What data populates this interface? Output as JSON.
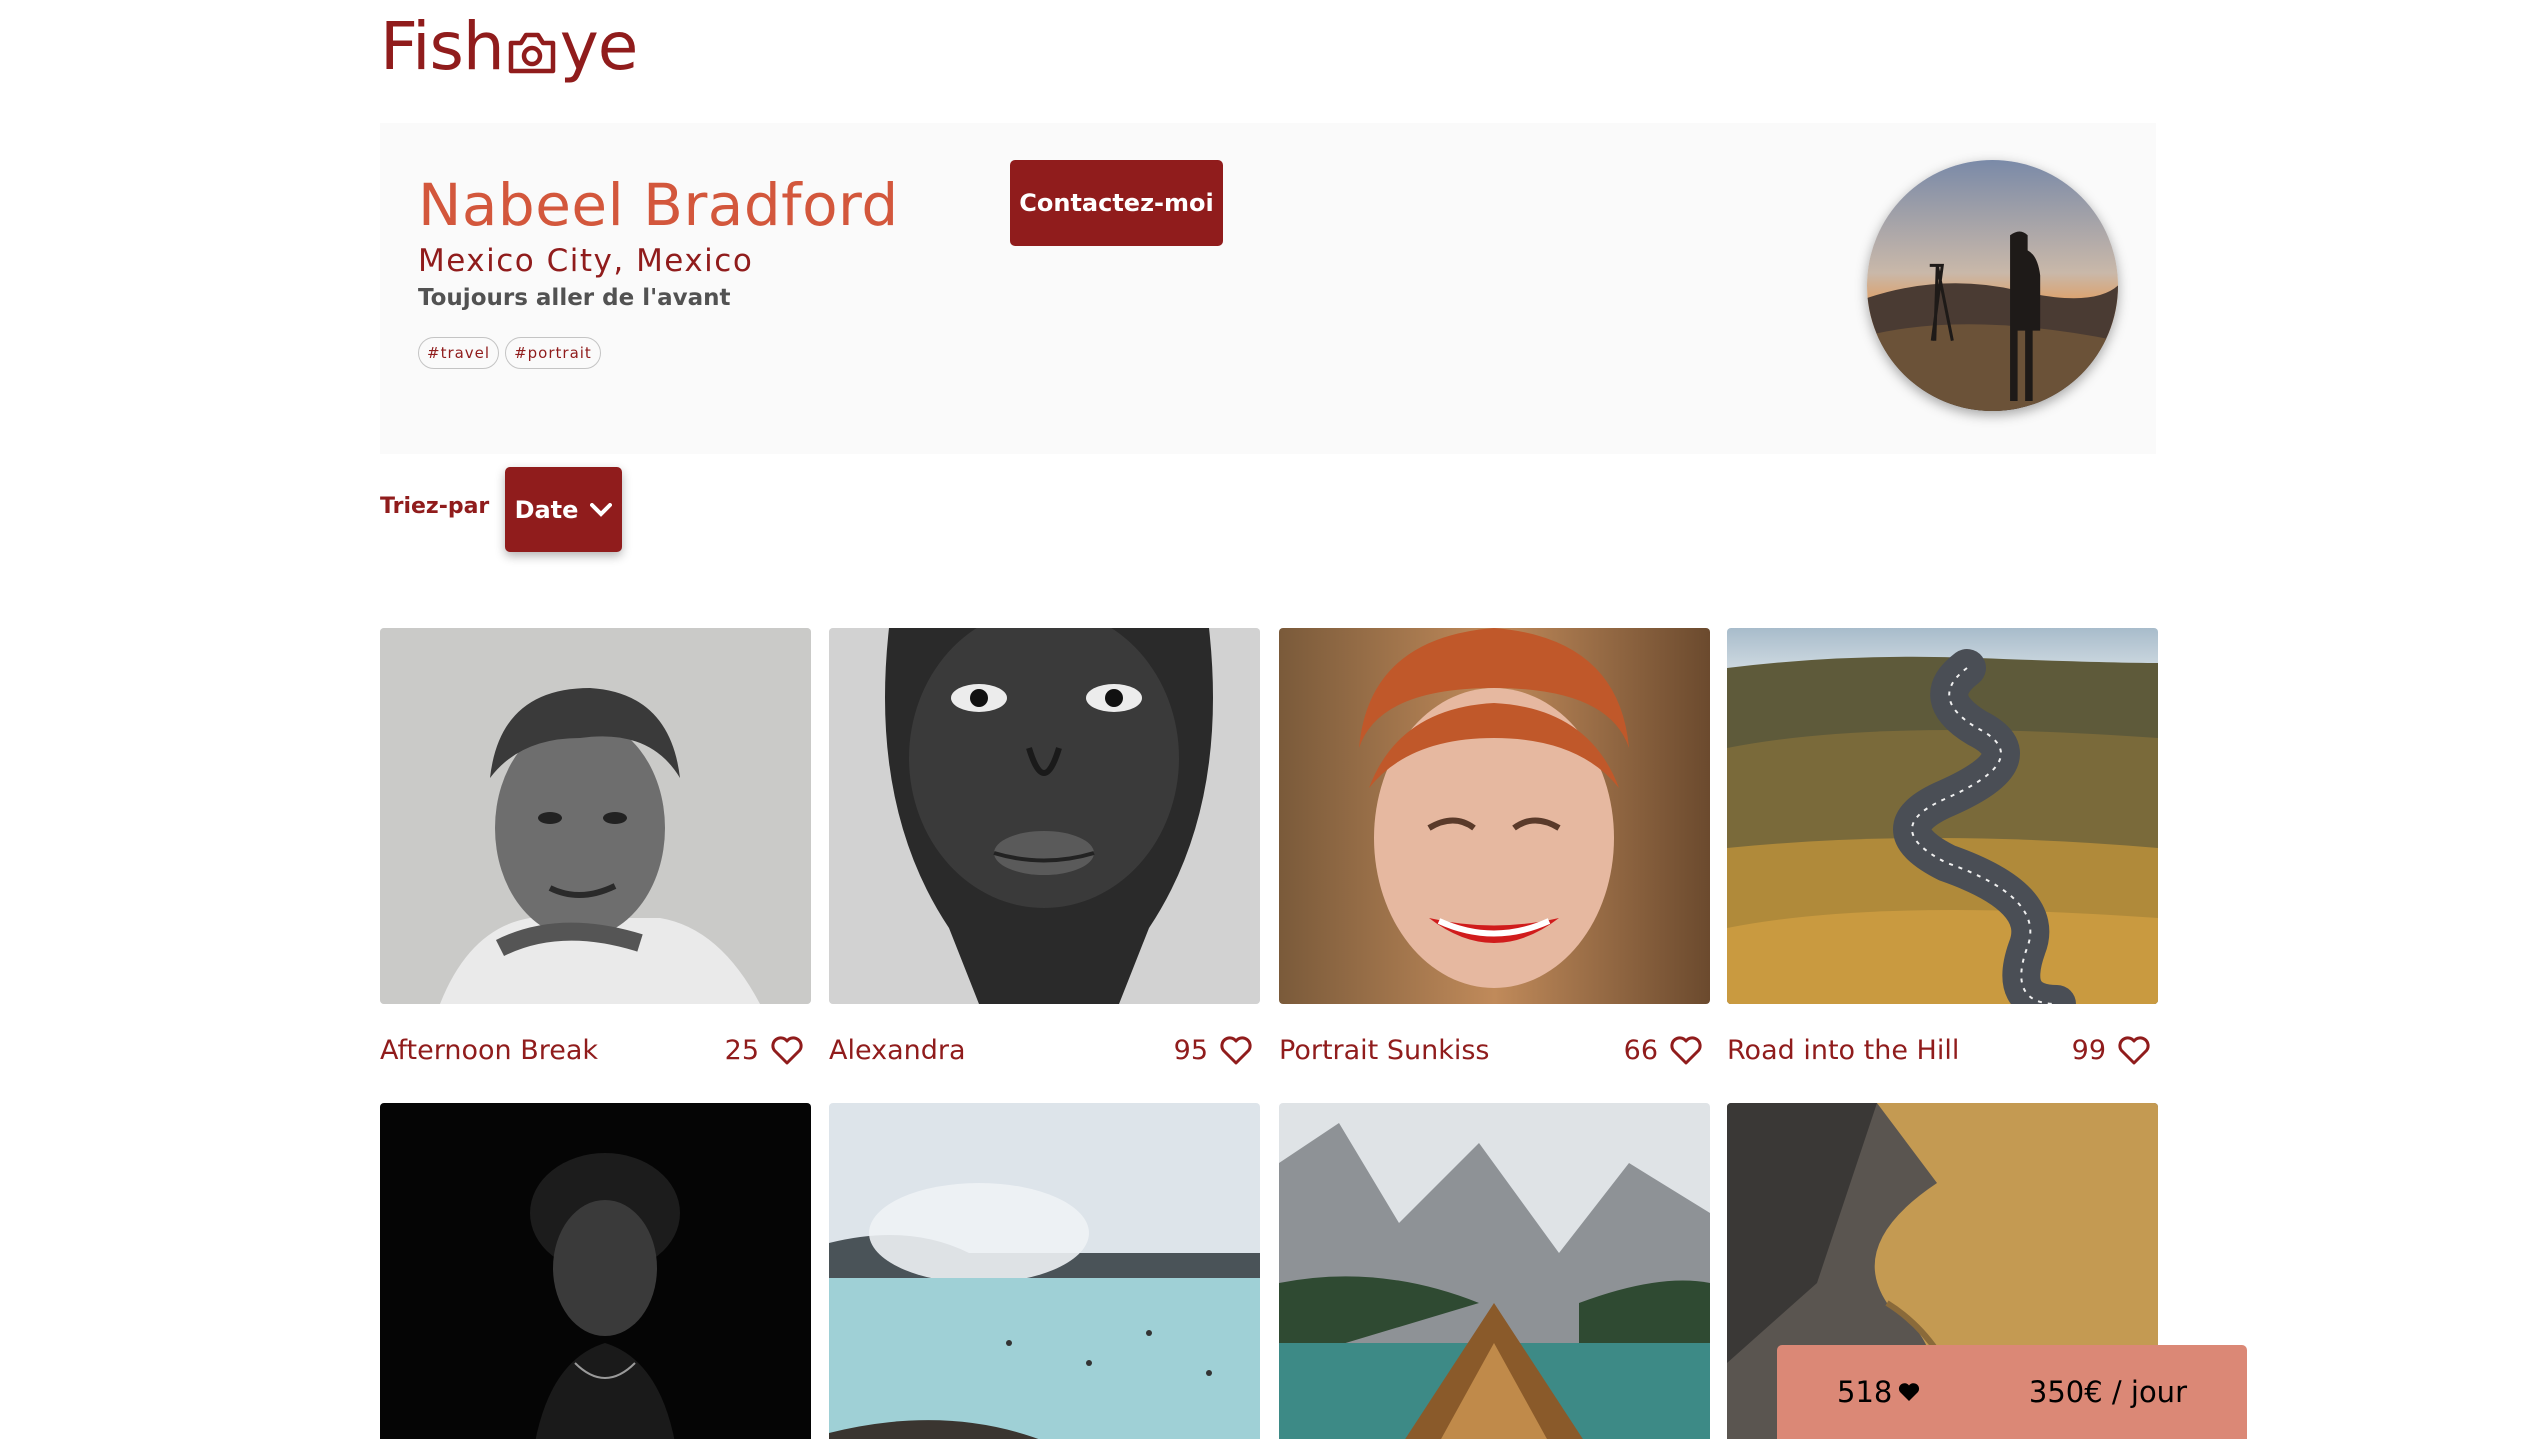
{
  "app": {
    "logo_left": "Fish",
    "logo_right": "ye"
  },
  "photographer": {
    "name": "Nabeel Bradford",
    "location": "Mexico City, Mexico",
    "tagline": "Toujours aller de l'avant",
    "tags": [
      "#travel",
      "#portrait"
    ],
    "contact_label": "Contactez-moi"
  },
  "sort": {
    "label": "Triez-par",
    "selected": "Date"
  },
  "gallery": [
    {
      "title": "Afternoon Break",
      "likes": "25"
    },
    {
      "title": "Alexandra",
      "likes": "95"
    },
    {
      "title": "Portrait Sunkiss",
      "likes": "66"
    },
    {
      "title": "Road into the Hill",
      "likes": "99"
    },
    {
      "title": "",
      "likes": ""
    },
    {
      "title": "",
      "likes": ""
    },
    {
      "title": "",
      "likes": ""
    },
    {
      "title": "",
      "likes": ""
    }
  ],
  "stats": {
    "total_likes": "518",
    "price": "350€ / jour"
  },
  "colors": {
    "primary": "#901c1c",
    "secondary": "#d3573c",
    "stats_bg": "#db8876",
    "header_bg": "#fafafa"
  }
}
